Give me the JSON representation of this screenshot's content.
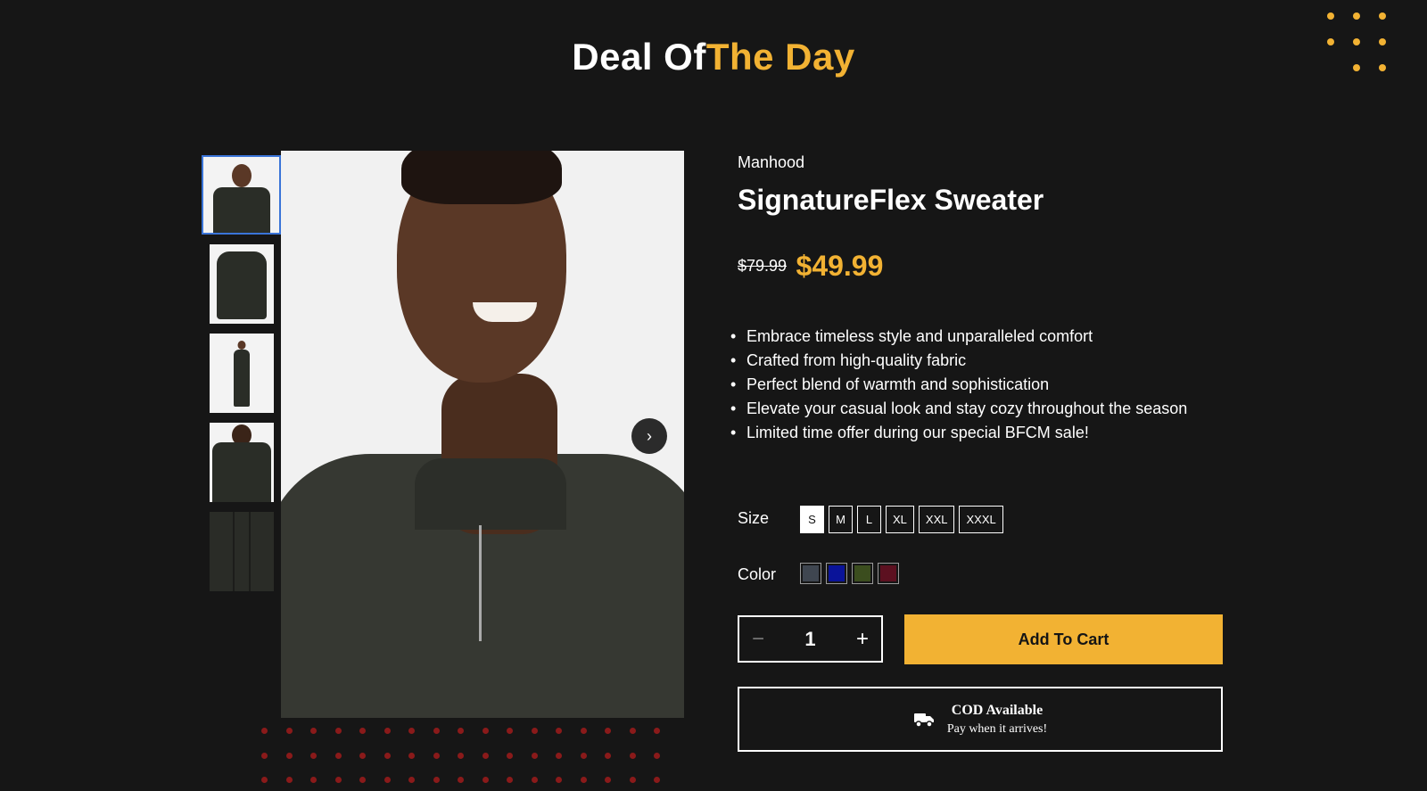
{
  "header": {
    "title_part1": "Deal Of",
    "title_part2": "The Day"
  },
  "product": {
    "brand": "Manhood",
    "name": "SignatureFlex Sweater",
    "old_price": "$79.99",
    "price": "$49.99",
    "features": [
      "Embrace timeless style and unparalleled comfort",
      "Crafted from high-quality fabric",
      "Perfect blend of warmth and sophistication",
      "Elevate your casual look and stay cozy throughout the season",
      "Limited time offer during our special BFCM sale!"
    ]
  },
  "size": {
    "label": "Size",
    "options": [
      "S",
      "M",
      "L",
      "XL",
      "XXL",
      "XXXL"
    ],
    "selected": "S"
  },
  "color": {
    "label": "Color",
    "options": [
      "#3f4650",
      "#0a1399",
      "#3b4d1e",
      "#5c1020"
    ]
  },
  "quantity": {
    "value": "1",
    "minus": "−",
    "plus": "+"
  },
  "cart": {
    "label": "Add To Cart"
  },
  "cod": {
    "title": "COD Available",
    "subtitle": "Pay when it arrives!"
  },
  "gallery": {
    "next": "›"
  },
  "colors": {
    "accent": "#f2b233",
    "background": "#161616",
    "selected_thumb_border": "#3a74d8"
  }
}
